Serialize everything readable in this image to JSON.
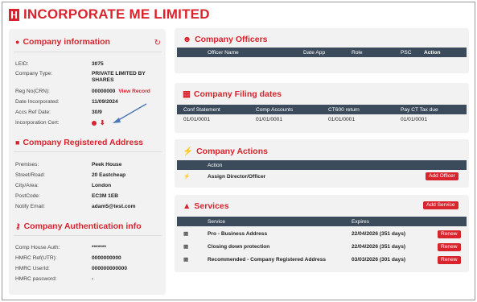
{
  "header": {
    "title": "INCORPORATE ME LIMITED"
  },
  "company_info": {
    "title": "Company information",
    "rows": [
      {
        "key": "LEID:",
        "value": "3075"
      },
      {
        "key": "Company Type:",
        "value": "PRIVATE LIMITED BY SHARES"
      },
      {
        "key": "Reg No(CRN):",
        "value": "00000000",
        "link": "View Record"
      },
      {
        "key": "Date Incorporated:",
        "value": "11/09/2024"
      },
      {
        "key": "Accs Ref Date:",
        "value": "30/9"
      },
      {
        "key": "Incorporation Cert:",
        "value": ""
      }
    ]
  },
  "registered_address": {
    "title": "Company Registered Address",
    "rows": [
      {
        "key": "Premises:",
        "value": "Peek House"
      },
      {
        "key": "Street/Road:",
        "value": "20 Eastcheap"
      },
      {
        "key": "City/Area:",
        "value": "London"
      },
      {
        "key": "PostCode:",
        "value": "EC3M 1EB"
      },
      {
        "key": "Notify Email:",
        "value": "adam5@test.com"
      }
    ]
  },
  "auth_info": {
    "title": "Company Authentication info",
    "rows": [
      {
        "key": "Comp House Auth:",
        "value": "*******"
      },
      {
        "key": "HMRC Ref(UTR):",
        "value": "0000000000"
      },
      {
        "key": "HMRC UserId:",
        "value": "000000000000"
      },
      {
        "key": "HMRC password:",
        "value": "-"
      }
    ]
  },
  "officers": {
    "title": "Company Officers",
    "columns": [
      "Officer Name",
      "Date App",
      "Role",
      "PSC",
      "Action"
    ]
  },
  "filing": {
    "title": "Company Filing dates",
    "columns": [
      "Conf Statement",
      "Comp Accounts",
      "CT600 return",
      "Pay CT Tax due"
    ],
    "row": [
      "01/01/0001",
      "01/01/0001",
      "01/01/0001",
      "01/01/0001"
    ]
  },
  "actions": {
    "title": "Company Actions",
    "columns": [
      "Action"
    ],
    "row_label": "Assign Director/Officer",
    "button": "Add Officer"
  },
  "services": {
    "title": "Services",
    "add_button": "Add Service",
    "columns": [
      "Service",
      "Expires"
    ],
    "rows": [
      {
        "service": "Pro - Business Address",
        "expires": "22/04/2026 (351 days)",
        "button": "Renew"
      },
      {
        "service": "Closing down protection",
        "expires": "22/04/2026 (351 days)",
        "button": "Renew"
      },
      {
        "service": "Recommended - Company Registered Address",
        "expires": "03/03/2026 (301 days)",
        "button": "Renew"
      }
    ]
  },
  "colors": {
    "accent": "#d9232d",
    "table_header": "#3b4b5c",
    "panel_bg": "#f2f2f2"
  }
}
